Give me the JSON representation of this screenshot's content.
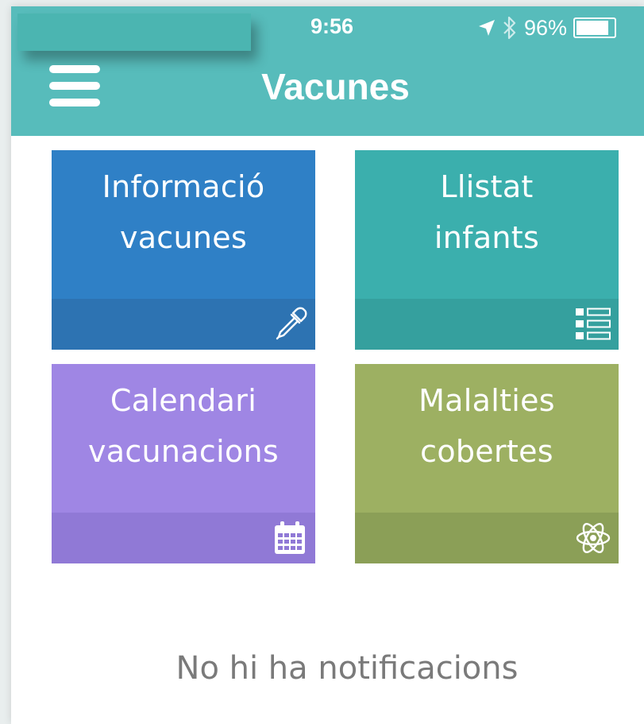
{
  "status_bar": {
    "time": "9:56",
    "battery_percent": "96%",
    "battery_level": 0.96,
    "icons": [
      "location-arrow-icon",
      "bluetooth-icon",
      "battery-icon"
    ]
  },
  "header": {
    "title": "Vacunes",
    "background": "#57bcbb",
    "menu_icon": "hamburger-menu-icon"
  },
  "tiles": [
    {
      "line1": "Informació",
      "line2": "vacunes",
      "color": "#2f80c6",
      "footer_color": "#2d73b2",
      "icon": "dropper-icon"
    },
    {
      "line1": "Llistat",
      "line2": "infants",
      "color": "#3bafad",
      "footer_color": "#35a09e",
      "icon": "list-icon"
    },
    {
      "line1": "Calendari",
      "line2": "vacunacions",
      "color": "#9f86e4",
      "footer_color": "#9079d6",
      "icon": "calendar-icon"
    },
    {
      "line1": "Malalties",
      "line2": "cobertes",
      "color": "#9db062",
      "footer_color": "#8b9f57",
      "icon": "atom-icon"
    }
  ],
  "notifications": {
    "empty_message": "No hi ha notificacions"
  }
}
